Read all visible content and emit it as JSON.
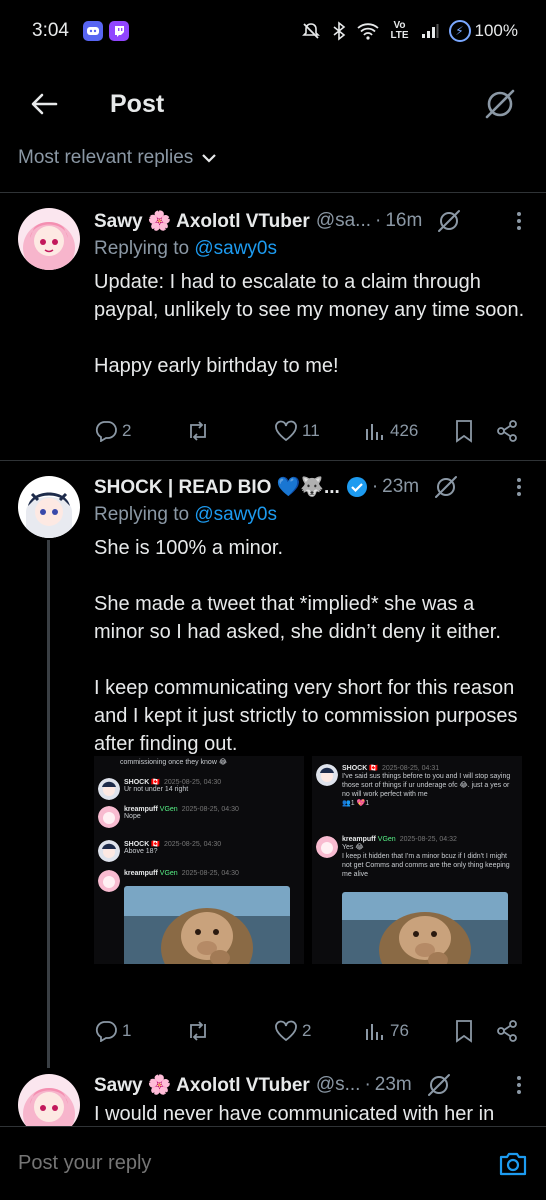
{
  "status": {
    "time": "3:04",
    "apps": [
      "discord-icon",
      "twitch-icon"
    ],
    "network": "Vo LTE",
    "battery": "100%"
  },
  "header": {
    "title": "Post"
  },
  "sort": {
    "label": "Most relevant replies"
  },
  "tweets": [
    {
      "name": "Sawy 🌸 Axolotl VTuber",
      "handle": "@sa...",
      "time": "16m",
      "replying_prefix": "Replying to ",
      "replying_to": "@sawy0s",
      "text": "Update: I had to escalate to a claim through paypal, unlikely to see my money any time soon.\n\nHappy early birthday to me!",
      "replies": "2",
      "reposts": "",
      "likes": "11",
      "views": "426"
    },
    {
      "name": "SHOCK | READ BIO 💙🐺...",
      "handle": "",
      "time": "23m",
      "replying_prefix": "Replying to ",
      "replying_to": "@sawy0s",
      "text": "She is 100% a minor.\n\nShe made a tweet that *implied* she was a minor so I had asked, she didn’t deny it either.\n\nI keep communicating very short for this reason and I kept it just strictly to commission purposes after finding out.",
      "replies": "1",
      "reposts": "",
      "likes": "2",
      "views": "76"
    },
    {
      "name": "Sawy 🌸 Axolotl VTuber",
      "handle": "@s...",
      "time": "23m",
      "text": "I would never have communicated with her in"
    }
  ],
  "media": {
    "left": {
      "top_text": "commissioning once they know 😂",
      "messages": [
        {
          "name": "SHOCK 🇨🇦",
          "time": "2025-08-25, 04:30",
          "text": "Ur not under 14 right"
        },
        {
          "name": "kreampuff",
          "tag": "VGen",
          "time": "2025-08-25, 04:30",
          "text": "Nope"
        },
        {
          "name": "SHOCK 🇨🇦",
          "time": "2025-08-25, 04:30",
          "text": "Above 18?"
        },
        {
          "name": "kreampuff",
          "tag": "VGen",
          "time": "2025-08-25, 04:30",
          "text": ""
        }
      ]
    },
    "right": {
      "messages": [
        {
          "name": "SHOCK 🇨🇦",
          "time": "2025-08-25, 04:31",
          "text": "I've said sus things before to you and I will stop saying those sort of things if ur underage ofc 😂. just a yes or no will work perfect with me",
          "reactions": "👥1 💖1"
        },
        {
          "name": "kreampuff",
          "tag": "VGen",
          "time": "2025-08-25, 04:32",
          "text": "Yes 😂\nI keep it hidden that I'm a minor bcuz if I didn't I might not get Comms and comms are the only thing keeping me alive"
        }
      ]
    }
  },
  "reply_bar": {
    "placeholder": "Post your reply"
  },
  "colors": {
    "background": "#000000",
    "text": "#e7e9ea",
    "muted": "#8b98a5",
    "link": "#1d9bf0",
    "divider": "#2f3336"
  }
}
